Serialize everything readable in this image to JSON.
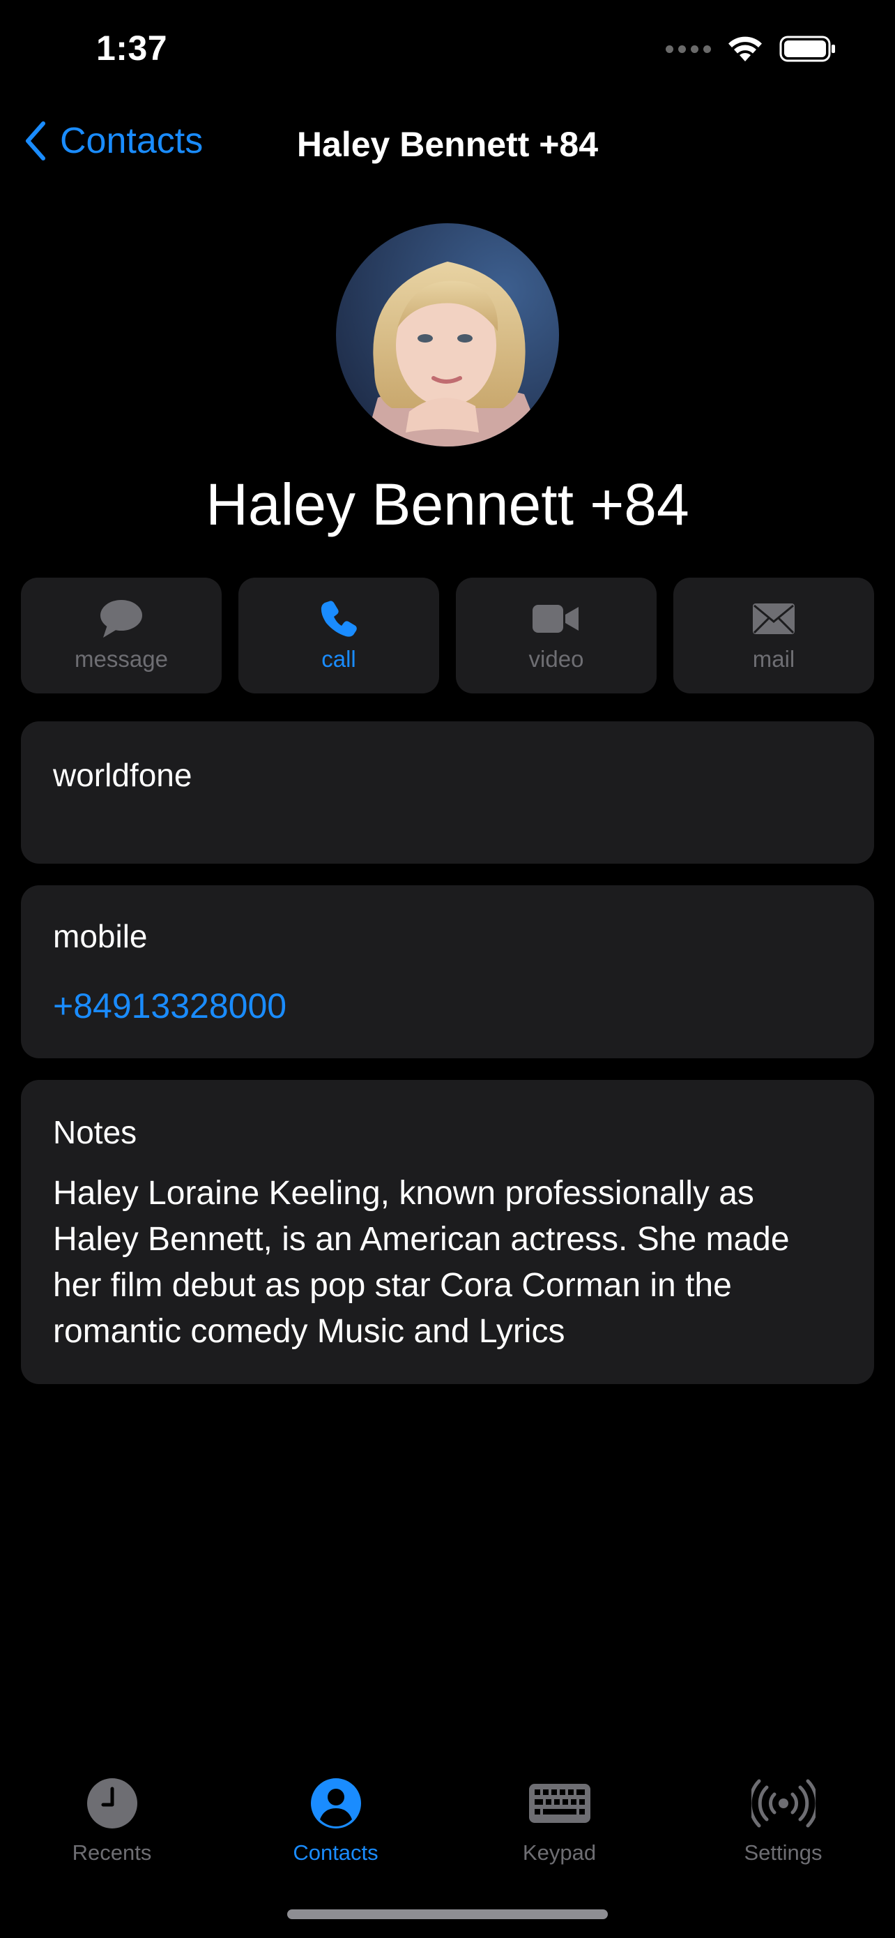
{
  "status_bar": {
    "time": "1:37"
  },
  "nav": {
    "back_label": "Contacts",
    "title": "Haley Bennett +84"
  },
  "contact": {
    "name": "Haley Bennett +84"
  },
  "actions": [
    {
      "id": "message",
      "label": "message",
      "icon": "message-bubble-icon",
      "active": false
    },
    {
      "id": "call",
      "label": "call",
      "icon": "phone-icon",
      "active": true
    },
    {
      "id": "video",
      "label": "video",
      "icon": "video-camera-icon",
      "active": false
    },
    {
      "id": "mail",
      "label": "mail",
      "icon": "envelope-icon",
      "active": false
    }
  ],
  "fields": {
    "worldfone": {
      "label": "worldfone"
    },
    "mobile": {
      "label": "mobile",
      "value": "+84913328000"
    }
  },
  "notes": {
    "label": "Notes",
    "text": "Haley Loraine Keeling, known professionally as Haley Bennett, is an American actress. She made her film debut as pop star Cora Corman in the romantic comedy Music and Lyrics"
  },
  "tabbar": [
    {
      "id": "recents",
      "label": "Recents",
      "icon": "clock-icon",
      "active": false
    },
    {
      "id": "contacts",
      "label": "Contacts",
      "icon": "person-circle-icon",
      "active": true
    },
    {
      "id": "keypad",
      "label": "Keypad",
      "icon": "keyboard-icon",
      "active": false
    },
    {
      "id": "settings",
      "label": "Settings",
      "icon": "broadcast-icon",
      "active": false
    }
  ],
  "colors": {
    "accent": "#1a8cff",
    "background": "#000000",
    "card": "#1c1c1e",
    "inactive": "#6e6e73"
  }
}
